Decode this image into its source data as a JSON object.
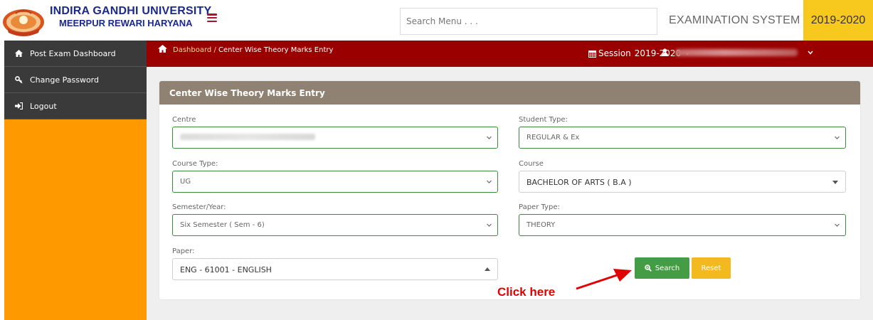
{
  "header": {
    "university_line1": "INDIRA GANDHI UNIVERSITY",
    "university_line2": "MEERPUR REWARI HARYANA",
    "search_placeholder": "Search Menu . . .",
    "system_title": "EXAMINATION SYSTEM",
    "session": "2019-2020"
  },
  "sidebar": {
    "items": [
      {
        "label": "Post Exam Dashboard",
        "icon": "home-icon"
      },
      {
        "label": "Change Password",
        "icon": "key-icon"
      },
      {
        "label": "Logout",
        "icon": "logout-icon"
      }
    ]
  },
  "breadcrumb": {
    "root": "Dashboard",
    "separator": " / ",
    "current": "Center Wise Theory Marks Entry",
    "session_label": "Session",
    "session_value": "2019-2020"
  },
  "form": {
    "title": "Center Wise Theory Marks Entry",
    "centre": {
      "label": "Centre",
      "value": ""
    },
    "student_type": {
      "label": "Student Type:",
      "value": "REGULAR & Ex"
    },
    "course_type": {
      "label": "Course Type:",
      "value": "UG"
    },
    "course": {
      "label": "Course",
      "value": "BACHELOR OF ARTS ( B.A )"
    },
    "semester": {
      "label": "Semester/Year:",
      "value": "Six Semester ( Sem - 6)"
    },
    "paper_type": {
      "label": "Paper Type:",
      "value": "THEORY"
    },
    "paper": {
      "label": "Paper:",
      "value": "ENG - 61001 - ENGLISH"
    },
    "search_label": "Search",
    "reset_label": "Reset"
  },
  "annotation": {
    "text": "Click here",
    "color": "#e30000"
  },
  "colors": {
    "breadcrumb_bg": "#9b0000",
    "sidebar_bg": "#ff9900",
    "nav_bg": "#3a3a3a",
    "card_header": "#8f8272",
    "session_badge": "#f7c81e",
    "search_button": "#449d44",
    "reset_button": "#f2ba1e"
  }
}
